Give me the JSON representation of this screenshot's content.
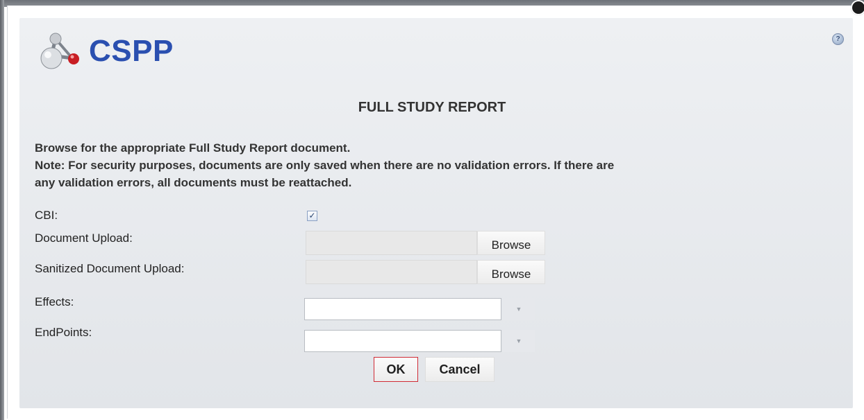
{
  "header": {
    "brand": "CSPP",
    "help_icon": "help-icon",
    "close_icon": "close-icon"
  },
  "dialog": {
    "title": "FULL STUDY REPORT",
    "instruction": "Browse for the appropriate Full Study Report document.",
    "note_line1": "Note: For security purposes, documents are only saved when there are no validation errors. If there are",
    "note_line2": "any validation errors, all documents must be reattached."
  },
  "form": {
    "cbi_label": "CBI:",
    "cbi_checked": true,
    "cbi_check_glyph": "✓",
    "document_upload_label": "Document Upload:",
    "document_upload_value": "",
    "sanitized_upload_label": "Sanitized Document Upload:",
    "sanitized_upload_value": "",
    "browse_label": "Browse",
    "effects_label": "Effects:",
    "effects_value": "",
    "endpoints_label": "EndPoints:",
    "endpoints_value": "",
    "dropdown_arrow": "▼"
  },
  "actions": {
    "ok_label": "OK",
    "cancel_label": "Cancel"
  },
  "colors": {
    "brand": "#2a4fb0",
    "ok_border": "#d02b35",
    "dialog_bg": "#e6e8ec"
  }
}
